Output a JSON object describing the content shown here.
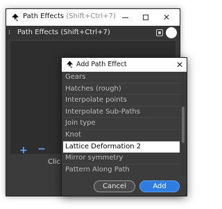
{
  "path_effects_window": {
    "title": "Path Effects",
    "shortcut": "(Shift+Ctrl+7)",
    "dock_title": "Path Effects  (Shift+Ctrl+7)",
    "add_label": "+",
    "remove_label": "−",
    "hint": "Click"
  },
  "add_dialog": {
    "title": "Add Path Effect",
    "close_label": "✕",
    "items": [
      "Gears",
      "Hatches (rough)",
      "Interpolate points",
      "Interpolate Sub-Paths",
      "Join type",
      "Knot",
      "Lattice Deformation 2",
      "Mirror symmetry",
      "Pattern Along Path"
    ],
    "selected_item": "Lattice Deformation 2",
    "cancel_label": "Cancel",
    "add_label": "Add"
  },
  "colors": {
    "panel_bg": "#3c3c3c",
    "accent": "#2f7de1",
    "selection": "#ffffff"
  }
}
